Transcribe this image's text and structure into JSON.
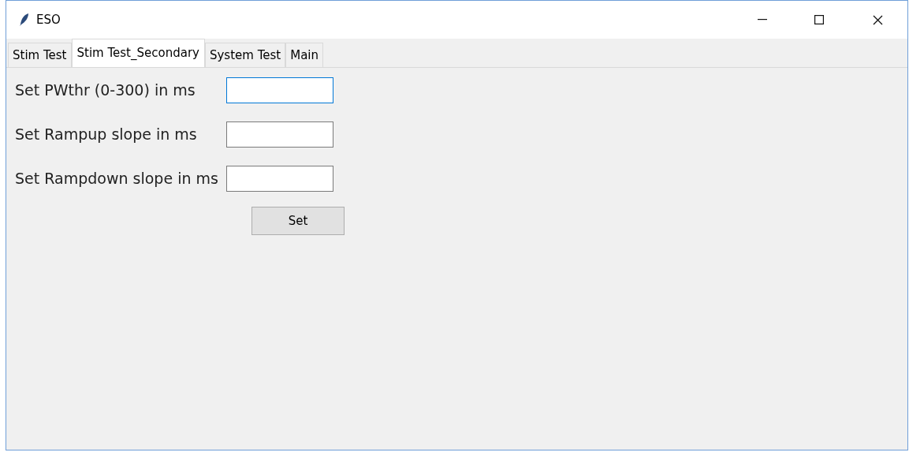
{
  "window": {
    "title": "ESO"
  },
  "tabs": [
    {
      "label": "Stim Test",
      "selected": false
    },
    {
      "label": "Stim Test_Secondary",
      "selected": true
    },
    {
      "label": "System Test",
      "selected": false
    },
    {
      "label": "Main",
      "selected": false
    }
  ],
  "fields": [
    {
      "label": "Set PWthr (0-300) in ms",
      "focused": true
    },
    {
      "label": "Set Rampup slope in ms",
      "focused": false
    },
    {
      "label": "Set Rampdown slope in ms",
      "focused": false
    }
  ],
  "button": "Set"
}
